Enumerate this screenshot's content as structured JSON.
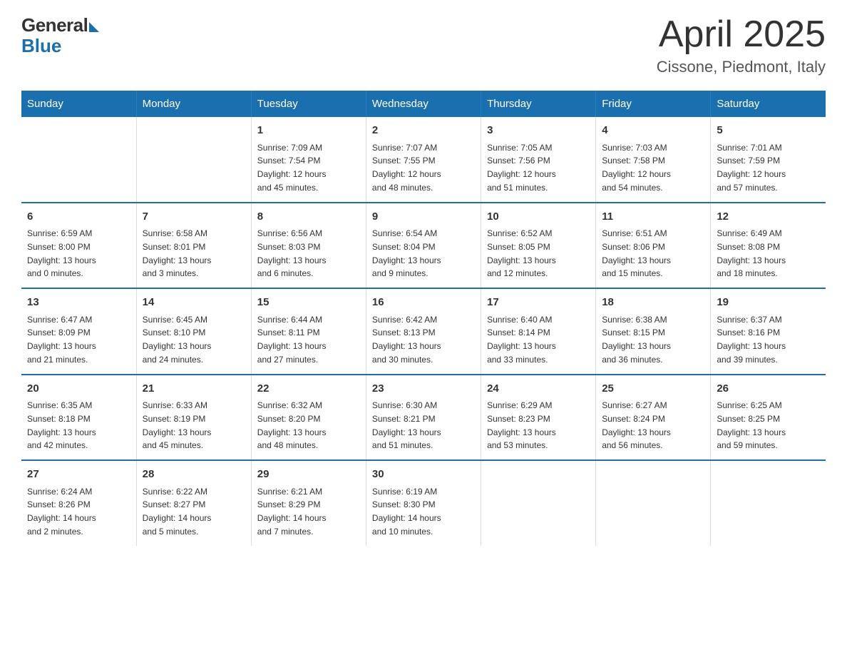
{
  "header": {
    "logo_general": "General",
    "logo_blue": "Blue",
    "month_title": "April 2025",
    "location": "Cissone, Piedmont, Italy"
  },
  "weekdays": [
    "Sunday",
    "Monday",
    "Tuesday",
    "Wednesday",
    "Thursday",
    "Friday",
    "Saturday"
  ],
  "weeks": [
    [
      {
        "day": "",
        "info": ""
      },
      {
        "day": "",
        "info": ""
      },
      {
        "day": "1",
        "info": "Sunrise: 7:09 AM\nSunset: 7:54 PM\nDaylight: 12 hours\nand 45 minutes."
      },
      {
        "day": "2",
        "info": "Sunrise: 7:07 AM\nSunset: 7:55 PM\nDaylight: 12 hours\nand 48 minutes."
      },
      {
        "day": "3",
        "info": "Sunrise: 7:05 AM\nSunset: 7:56 PM\nDaylight: 12 hours\nand 51 minutes."
      },
      {
        "day": "4",
        "info": "Sunrise: 7:03 AM\nSunset: 7:58 PM\nDaylight: 12 hours\nand 54 minutes."
      },
      {
        "day": "5",
        "info": "Sunrise: 7:01 AM\nSunset: 7:59 PM\nDaylight: 12 hours\nand 57 minutes."
      }
    ],
    [
      {
        "day": "6",
        "info": "Sunrise: 6:59 AM\nSunset: 8:00 PM\nDaylight: 13 hours\nand 0 minutes."
      },
      {
        "day": "7",
        "info": "Sunrise: 6:58 AM\nSunset: 8:01 PM\nDaylight: 13 hours\nand 3 minutes."
      },
      {
        "day": "8",
        "info": "Sunrise: 6:56 AM\nSunset: 8:03 PM\nDaylight: 13 hours\nand 6 minutes."
      },
      {
        "day": "9",
        "info": "Sunrise: 6:54 AM\nSunset: 8:04 PM\nDaylight: 13 hours\nand 9 minutes."
      },
      {
        "day": "10",
        "info": "Sunrise: 6:52 AM\nSunset: 8:05 PM\nDaylight: 13 hours\nand 12 minutes."
      },
      {
        "day": "11",
        "info": "Sunrise: 6:51 AM\nSunset: 8:06 PM\nDaylight: 13 hours\nand 15 minutes."
      },
      {
        "day": "12",
        "info": "Sunrise: 6:49 AM\nSunset: 8:08 PM\nDaylight: 13 hours\nand 18 minutes."
      }
    ],
    [
      {
        "day": "13",
        "info": "Sunrise: 6:47 AM\nSunset: 8:09 PM\nDaylight: 13 hours\nand 21 minutes."
      },
      {
        "day": "14",
        "info": "Sunrise: 6:45 AM\nSunset: 8:10 PM\nDaylight: 13 hours\nand 24 minutes."
      },
      {
        "day": "15",
        "info": "Sunrise: 6:44 AM\nSunset: 8:11 PM\nDaylight: 13 hours\nand 27 minutes."
      },
      {
        "day": "16",
        "info": "Sunrise: 6:42 AM\nSunset: 8:13 PM\nDaylight: 13 hours\nand 30 minutes."
      },
      {
        "day": "17",
        "info": "Sunrise: 6:40 AM\nSunset: 8:14 PM\nDaylight: 13 hours\nand 33 minutes."
      },
      {
        "day": "18",
        "info": "Sunrise: 6:38 AM\nSunset: 8:15 PM\nDaylight: 13 hours\nand 36 minutes."
      },
      {
        "day": "19",
        "info": "Sunrise: 6:37 AM\nSunset: 8:16 PM\nDaylight: 13 hours\nand 39 minutes."
      }
    ],
    [
      {
        "day": "20",
        "info": "Sunrise: 6:35 AM\nSunset: 8:18 PM\nDaylight: 13 hours\nand 42 minutes."
      },
      {
        "day": "21",
        "info": "Sunrise: 6:33 AM\nSunset: 8:19 PM\nDaylight: 13 hours\nand 45 minutes."
      },
      {
        "day": "22",
        "info": "Sunrise: 6:32 AM\nSunset: 8:20 PM\nDaylight: 13 hours\nand 48 minutes."
      },
      {
        "day": "23",
        "info": "Sunrise: 6:30 AM\nSunset: 8:21 PM\nDaylight: 13 hours\nand 51 minutes."
      },
      {
        "day": "24",
        "info": "Sunrise: 6:29 AM\nSunset: 8:23 PM\nDaylight: 13 hours\nand 53 minutes."
      },
      {
        "day": "25",
        "info": "Sunrise: 6:27 AM\nSunset: 8:24 PM\nDaylight: 13 hours\nand 56 minutes."
      },
      {
        "day": "26",
        "info": "Sunrise: 6:25 AM\nSunset: 8:25 PM\nDaylight: 13 hours\nand 59 minutes."
      }
    ],
    [
      {
        "day": "27",
        "info": "Sunrise: 6:24 AM\nSunset: 8:26 PM\nDaylight: 14 hours\nand 2 minutes."
      },
      {
        "day": "28",
        "info": "Sunrise: 6:22 AM\nSunset: 8:27 PM\nDaylight: 14 hours\nand 5 minutes."
      },
      {
        "day": "29",
        "info": "Sunrise: 6:21 AM\nSunset: 8:29 PM\nDaylight: 14 hours\nand 7 minutes."
      },
      {
        "day": "30",
        "info": "Sunrise: 6:19 AM\nSunset: 8:30 PM\nDaylight: 14 hours\nand 10 minutes."
      },
      {
        "day": "",
        "info": ""
      },
      {
        "day": "",
        "info": ""
      },
      {
        "day": "",
        "info": ""
      }
    ]
  ]
}
